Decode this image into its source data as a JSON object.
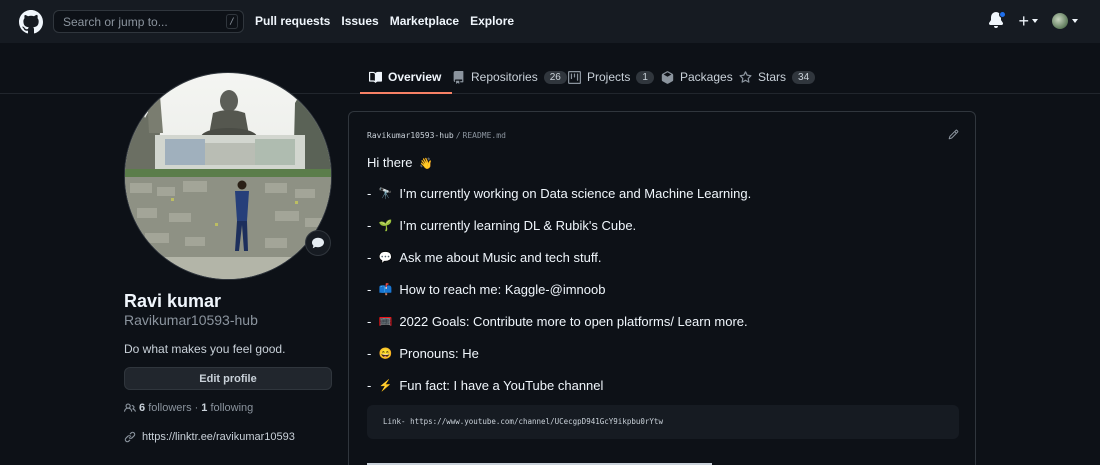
{
  "nav": {
    "search_placeholder": "Search or jump to...",
    "search_shortcut": "/",
    "links": [
      "Pull requests",
      "Issues",
      "Marketplace",
      "Explore"
    ],
    "plus_label": "+"
  },
  "tabs": [
    {
      "label": "Overview",
      "count": null,
      "icon": "book-icon",
      "active": true
    },
    {
      "label": "Repositories",
      "count": "26",
      "icon": "repo-icon"
    },
    {
      "label": "Projects",
      "count": "1",
      "icon": "project-icon"
    },
    {
      "label": "Packages",
      "count": null,
      "icon": "package-icon"
    },
    {
      "label": "Stars",
      "count": "34",
      "icon": "star-icon"
    }
  ],
  "profile": {
    "name": "Ravi kumar",
    "username": "Ravikumar10593-hub",
    "bio": "Do what makes you feel good.",
    "edit_button": "Edit profile",
    "followers_count": "6",
    "followers_label": "followers",
    "separator": "·",
    "following_count": "1",
    "following_label": "following",
    "link": "https://linktr.ee/ravikumar10593"
  },
  "readme": {
    "owner": "Ravikumar10593-hub",
    "sep": "/",
    "file": "README.md",
    "greeting": "Hi there",
    "greeting_emoji": "👋",
    "bullets": [
      {
        "emoji": "🔭",
        "text": "I’m currently working on Data science and Machine Learning."
      },
      {
        "emoji": "🌱",
        "text": "I’m currently learning DL & Rubik's Cube."
      },
      {
        "emoji": "💬",
        "text": "Ask me about Music and tech stuff."
      },
      {
        "emoji": "📫",
        "text": "How to reach me: Kaggle-@imnoob"
      },
      {
        "emoji": "🥅",
        "text": "2022 Goals: Contribute more to open platforms/ Learn more."
      },
      {
        "emoji": "😄",
        "text": "Pronouns: He"
      },
      {
        "emoji": "⚡",
        "text": "Fun fact: I have a YouTube channel"
      }
    ],
    "bullet_dash": "-",
    "code_text": "Link- https://www.youtube.com/channel/UCecgpD941GcY9ikpbu0rYtw"
  },
  "colors": {
    "background": "#0d1117",
    "header": "#161b22",
    "tab_underline": "#f78166",
    "notification_dot": "#1f6feb"
  }
}
